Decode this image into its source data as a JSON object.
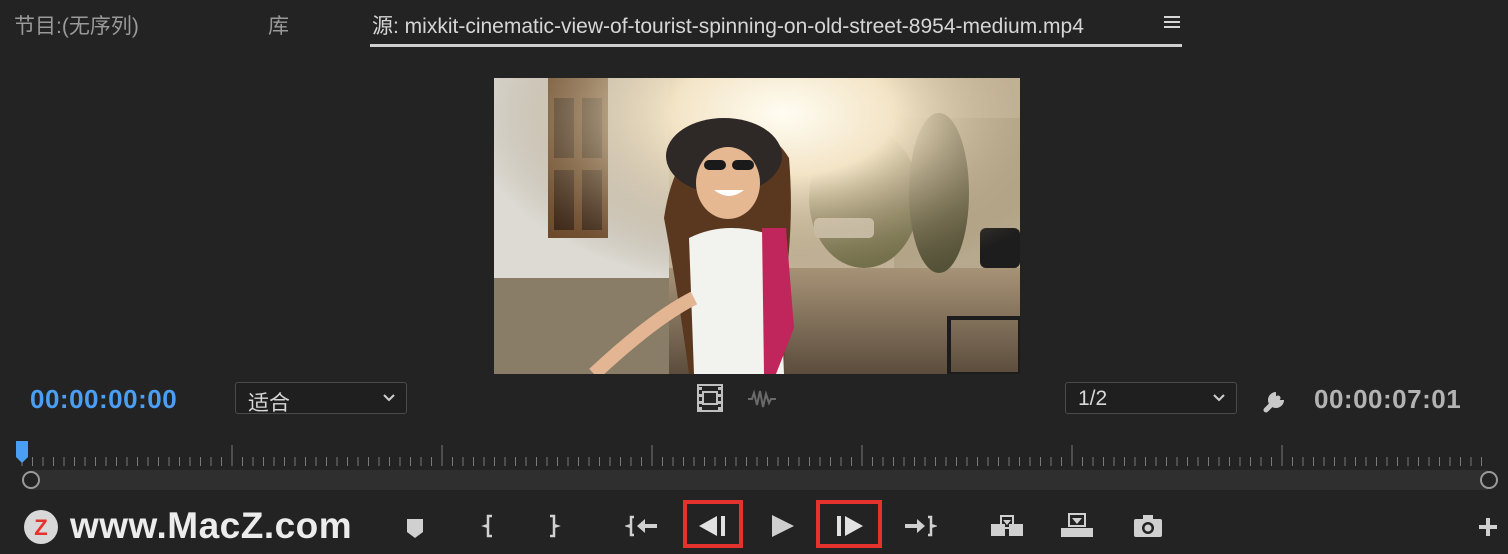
{
  "tabs": {
    "program": "节目:(无序列)",
    "library": "库",
    "source": "源: mixkit-cinematic-view-of-tourist-spinning-on-old-street-8954-medium.mp4"
  },
  "monitor": {
    "current_timecode": "00:00:00:00",
    "zoom_value": "适合",
    "resolution_value": "1/2",
    "duration_timecode": "00:00:07:01",
    "playhead_position": 0
  },
  "watermark": {
    "logo_letter": "Z",
    "text": "www.MacZ.com"
  },
  "controls": [
    "add-marker",
    "mark-in",
    "mark-out",
    "go-to-in",
    "step-back",
    "play",
    "step-forward",
    "go-to-out",
    "insert",
    "overwrite",
    "export-frame",
    "button-editor"
  ],
  "colors": {
    "accent_blue": "#4a9ff5",
    "highlight_red": "#e5322d",
    "background": "#232323"
  }
}
